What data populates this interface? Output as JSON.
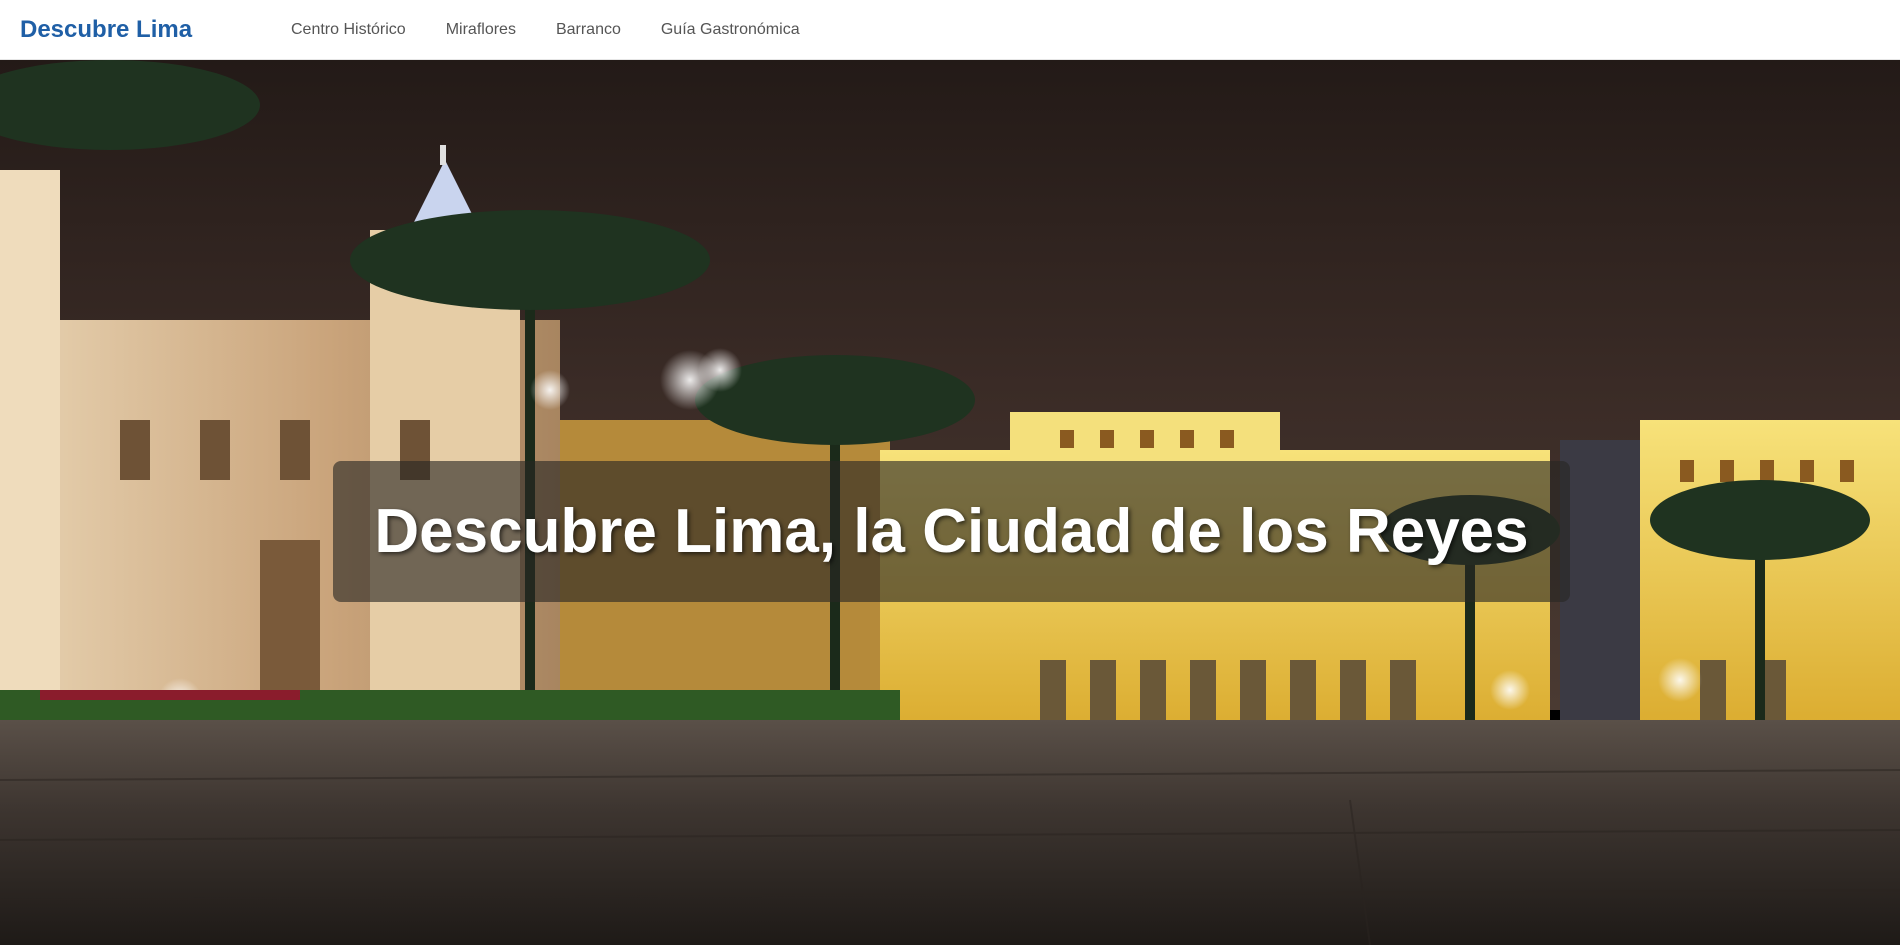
{
  "nav": {
    "brand": "Descubre Lima",
    "links": [
      {
        "label": "Centro Histórico"
      },
      {
        "label": "Miraflores"
      },
      {
        "label": "Barranco"
      },
      {
        "label": "Guía Gastronómica"
      }
    ]
  },
  "hero": {
    "title": "Descubre Lima, la Ciudad de los Reyes",
    "image_subject": "Plaza Mayor de Lima at night"
  },
  "colors": {
    "brand": "#1f5fa6",
    "nav_link": "#555555",
    "nav_background": "#ffffff",
    "title_text": "#ffffff"
  }
}
